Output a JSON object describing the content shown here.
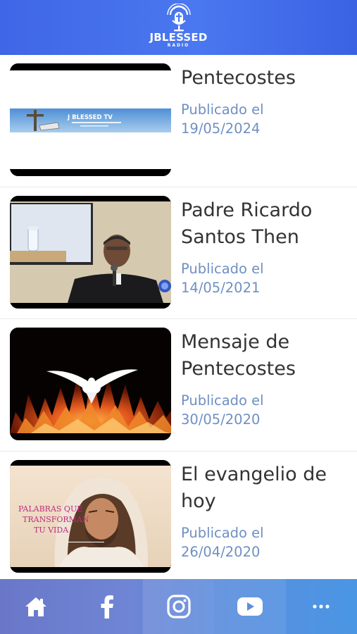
{
  "header": {
    "logo_title": "JBLESSED",
    "logo_subtitle": "RADIO",
    "logo_icon": "microphone-cross-icon"
  },
  "videos": [
    {
      "title": "Pentecostes",
      "published_label": "Publicado el",
      "date": "19/05/2024",
      "thumb_text": "J BLESSED TV"
    },
    {
      "title": "Padre Ricardo Santos Then",
      "published_label": "Publicado el",
      "date": "14/05/2021"
    },
    {
      "title": "Mensaje de Pentecostes",
      "published_label": "Publicado el",
      "date": "30/05/2020"
    },
    {
      "title": "El evangelio de hoy",
      "published_label": "Publicado el",
      "date": "26/04/2020",
      "thumb_text": "PALABRAS QUE TRANSFORMAN TU VIDA"
    }
  ],
  "tabbar": {
    "items": [
      {
        "icon": "home-icon"
      },
      {
        "icon": "facebook-icon"
      },
      {
        "icon": "instagram-icon"
      },
      {
        "icon": "youtube-icon"
      },
      {
        "icon": "more-icon"
      }
    ]
  },
  "colors": {
    "header": "#4a78f0",
    "title_text": "#333333",
    "date_text": "#6f8fc3"
  }
}
